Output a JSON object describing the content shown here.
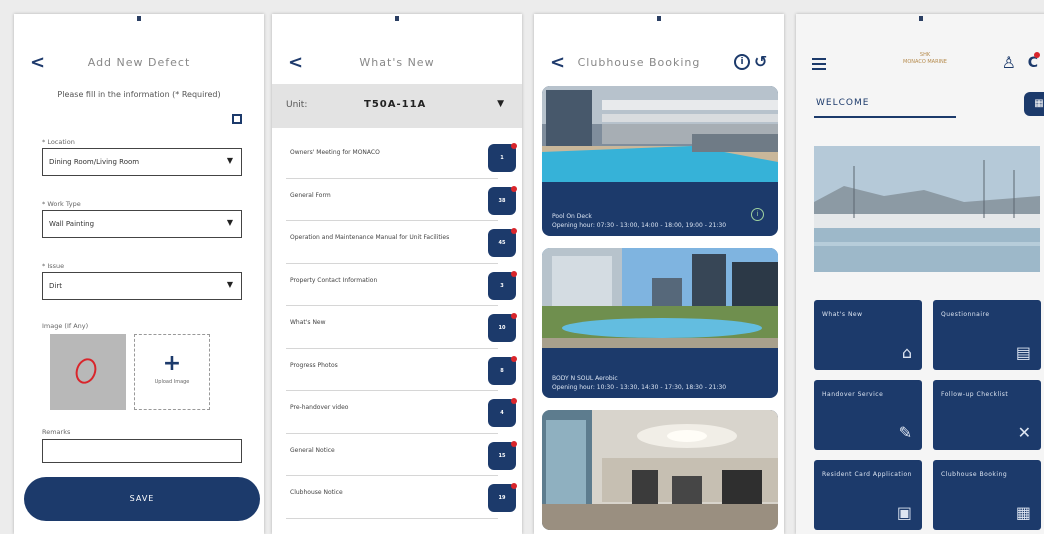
{
  "screen1": {
    "title": "Add New Defect",
    "back": "<",
    "intro": "Please fill in the information (* Required)",
    "fields": [
      {
        "label": "* Location",
        "value": "Dining Room/Living Room"
      },
      {
        "label": "* Work Type",
        "value": "Wall Painting"
      },
      {
        "label": "* Issue",
        "value": "Dirt"
      }
    ],
    "image_label": "Image (If Any)",
    "upload_plus": "+",
    "upload_label": "Upload Image",
    "remarks_label": "Remarks",
    "save_label": "SAVE"
  },
  "screen2": {
    "title": "What's New",
    "back": "<",
    "unit_label": "Unit:",
    "unit_value": "T50A-11A",
    "unit_arrow": "▼",
    "items": [
      {
        "text": "Owners' Meeting for MONACO",
        "count": "1"
      },
      {
        "text": "General Form",
        "count": "38"
      },
      {
        "text": "Operation and Maintenance Manual for Unit Facilities",
        "count": "45"
      },
      {
        "text": "Property Contact Information",
        "count": "3"
      },
      {
        "text": "What's New",
        "count": "10"
      },
      {
        "text": "Progress Photos",
        "count": "8"
      },
      {
        "text": "Pre-handover video",
        "count": "4"
      },
      {
        "text": "General Notice",
        "count": "15"
      },
      {
        "text": "Clubhouse Notice",
        "count": "19"
      }
    ]
  },
  "screen3": {
    "title": "Clubhouse Booking",
    "back": "<",
    "info_glyph": "i",
    "history_glyph": "↺",
    "cards": [
      {
        "name": "Pool On Deck",
        "hours": "Opening hour: 07:30 - 13:00, 14:00 - 18:00, 19:00 - 21:30",
        "info": "i"
      },
      {
        "name": "BODY N SOUL Aerobic",
        "hours": "Opening hour: 10:30 - 13:30, 14:30 - 17:30, 18:30 - 21:30"
      }
    ]
  },
  "screen4": {
    "logo_top": "SHK",
    "logo_bottom": "MONACO MARINE",
    "user_glyph": "♙",
    "bell_glyph": "C",
    "qr_glyph": "▦",
    "welcome": "WELCOME",
    "tiles": [
      {
        "label": "What's New",
        "icon": "⌂"
      },
      {
        "label": "Questionnaire",
        "icon": "▤"
      },
      {
        "label": "Handover Service",
        "icon": "✎"
      },
      {
        "label": "Follow-up Checklist",
        "icon": "✕"
      },
      {
        "label": "Resident Card Application",
        "icon": "▣"
      },
      {
        "label": "Clubhouse Booking",
        "icon": "▦"
      }
    ]
  },
  "colors": {
    "navy": "#1c3a6b",
    "badge_red": "#d9252b"
  }
}
